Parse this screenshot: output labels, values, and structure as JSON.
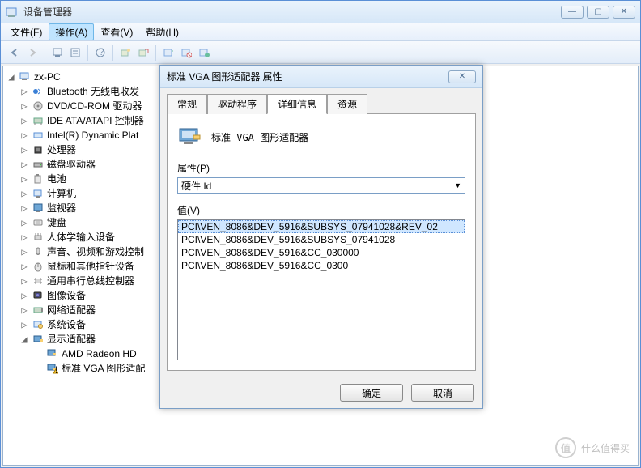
{
  "window": {
    "title": "设备管理器",
    "buttons": {
      "min": "—",
      "max": "▢",
      "close": "✕"
    }
  },
  "menu": {
    "file": "文件(F)",
    "action": "操作(A)",
    "view": "查看(V)",
    "help": "帮助(H)"
  },
  "tree": {
    "root": "zx-PC",
    "items": [
      "Bluetooth 无线电收发",
      "DVD/CD-ROM 驱动器",
      "IDE ATA/ATAPI 控制器",
      "Intel(R) Dynamic Plat",
      "处理器",
      "磁盘驱动器",
      "电池",
      "计算机",
      "监视器",
      "键盘",
      "人体学输入设备",
      "声音、视频和游戏控制",
      "鼠标和其他指针设备",
      "通用串行总线控制器",
      "图像设备",
      "网络适配器",
      "系统设备",
      "显示适配器"
    ],
    "children": [
      "AMD Radeon HD",
      "标准 VGA 图形适配"
    ]
  },
  "dialog": {
    "title": "标准 VGA 图形适配器 属性",
    "tabs": {
      "general": "常规",
      "driver": "驱动程序",
      "details": "详细信息",
      "resources": "资源"
    },
    "device_name": "标准 VGA 图形适配器",
    "prop_label": "属性(P)",
    "prop_value": "硬件 Id",
    "value_label": "值(V)",
    "values": [
      "PCI\\VEN_8086&DEV_5916&SUBSYS_07941028&REV_02",
      "PCI\\VEN_8086&DEV_5916&SUBSYS_07941028",
      "PCI\\VEN_8086&DEV_5916&CC_030000",
      "PCI\\VEN_8086&DEV_5916&CC_0300"
    ],
    "ok": "确定",
    "cancel": "取消"
  },
  "watermark": {
    "symbol": "值",
    "text": "什么值得买"
  }
}
